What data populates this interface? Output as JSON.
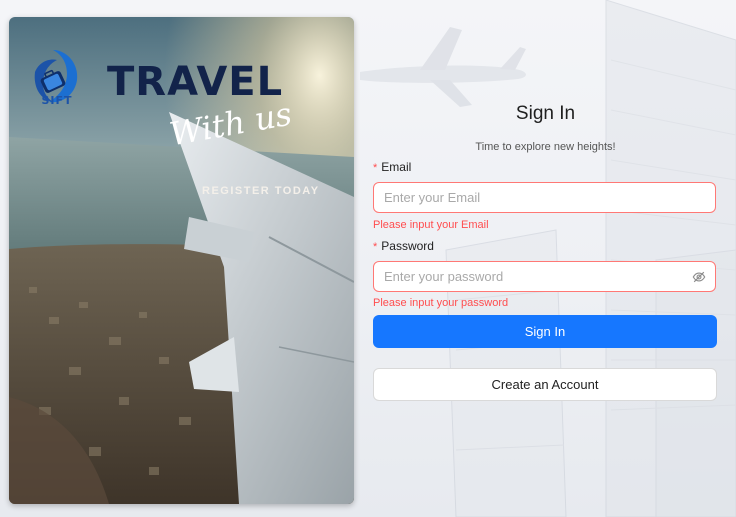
{
  "poster": {
    "logo_text": "SIFT",
    "title": "TRAVEL",
    "tagline": "With us",
    "cta": "REGISTER TODAY"
  },
  "signin": {
    "title": "Sign In",
    "subtitle": "Time to explore new heights!",
    "email_label": "Email",
    "email_placeholder": "Enter your Email",
    "email_error": "Please input your Email",
    "password_label": "Password",
    "password_placeholder": "Enter your password",
    "password_error": "Please input your password",
    "required_marker": "*",
    "signin_button": "Sign In",
    "create_account_button": "Create an Account"
  },
  "icons": {
    "password_toggle": "eye-invisible-icon",
    "logo": "sift-logo-icon"
  },
  "colors": {
    "primary": "#1677ff",
    "error": "#ff4d4f",
    "poster_title": "#12234a",
    "logo_blue": "#1c53a8"
  }
}
